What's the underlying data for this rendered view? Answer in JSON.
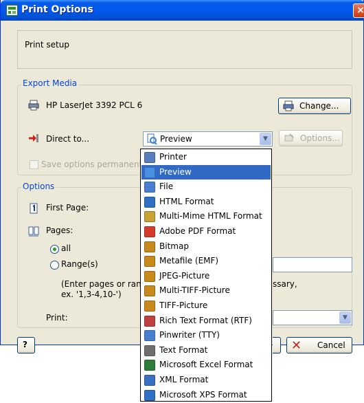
{
  "window": {
    "title": "Print Options",
    "close_glyph": "×"
  },
  "description": "Print setup",
  "export_media": {
    "legend": "Export Media",
    "printer_name": "HP LaserJet 3392 PCL 6",
    "change_label": "Change...",
    "direct_to_label": "Direct to...",
    "direct_to_value": "Preview",
    "options_label": "Options...",
    "save_options_label": "Save options permanently"
  },
  "dropdown": {
    "selected_index": 1,
    "items": [
      {
        "label": "Printer",
        "icon": "printer-icon",
        "color": "#5a7fbf"
      },
      {
        "label": "Preview",
        "icon": "preview-icon",
        "color": "#4a90e2"
      },
      {
        "label": "File",
        "icon": "file-icon",
        "color": "#4a7fcf"
      },
      {
        "label": "HTML Format",
        "icon": "html-icon",
        "color": "#2f6fc4"
      },
      {
        "label": "Multi-Mime HTML Format",
        "icon": "mime-icon",
        "color": "#c8a233"
      },
      {
        "label": "Adobe PDF Format",
        "icon": "pdf-icon",
        "color": "#d63a2a"
      },
      {
        "label": "Bitmap",
        "icon": "bitmap-icon",
        "color": "#c98a1d"
      },
      {
        "label": "Metafile (EMF)",
        "icon": "metafile-icon",
        "color": "#c98a1d"
      },
      {
        "label": "JPEG-Picture",
        "icon": "jpeg-icon",
        "color": "#c98a1d"
      },
      {
        "label": "Multi-TIFF-Picture",
        "icon": "multi-tiff-icon",
        "color": "#c98a1d"
      },
      {
        "label": "TIFF-Picture",
        "icon": "tiff-icon",
        "color": "#c98a1d"
      },
      {
        "label": "Rich Text Format (RTF)",
        "icon": "rtf-icon",
        "color": "#c04040"
      },
      {
        "label": "Pinwriter (TTY)",
        "icon": "pinwriter-icon",
        "color": "#4a7fcf"
      },
      {
        "label": "Text Format",
        "icon": "text-icon",
        "color": "#6f6f6f"
      },
      {
        "label": "Microsoft Excel Format",
        "icon": "excel-icon",
        "color": "#2f7d3a"
      },
      {
        "label": "XML Format",
        "icon": "xml-icon",
        "color": "#3a6fc4"
      },
      {
        "label": "Microsoft XPS Format",
        "icon": "xps-icon",
        "color": "#2f6fc4"
      }
    ]
  },
  "options": {
    "legend": "Options",
    "first_page_label": "First Page:",
    "pages_label": "Pages:",
    "all_label": "all",
    "range_label": "Range(s)",
    "range_help": "(Enter pages or range(s) separated by commas. If necessary,",
    "range_help_line2": "ex. '1,3-4,10-')",
    "range_help_hidden_left": "(Enter pages or rang",
    "range_help_hidden_right": "ssary,",
    "print_label": "Print:"
  },
  "footer": {
    "help_glyph": "?",
    "cancel_label": "Cancel"
  },
  "colors": {
    "accent": "#0046d5",
    "selection": "#316ac5",
    "window_bg": "#ece9d8"
  }
}
